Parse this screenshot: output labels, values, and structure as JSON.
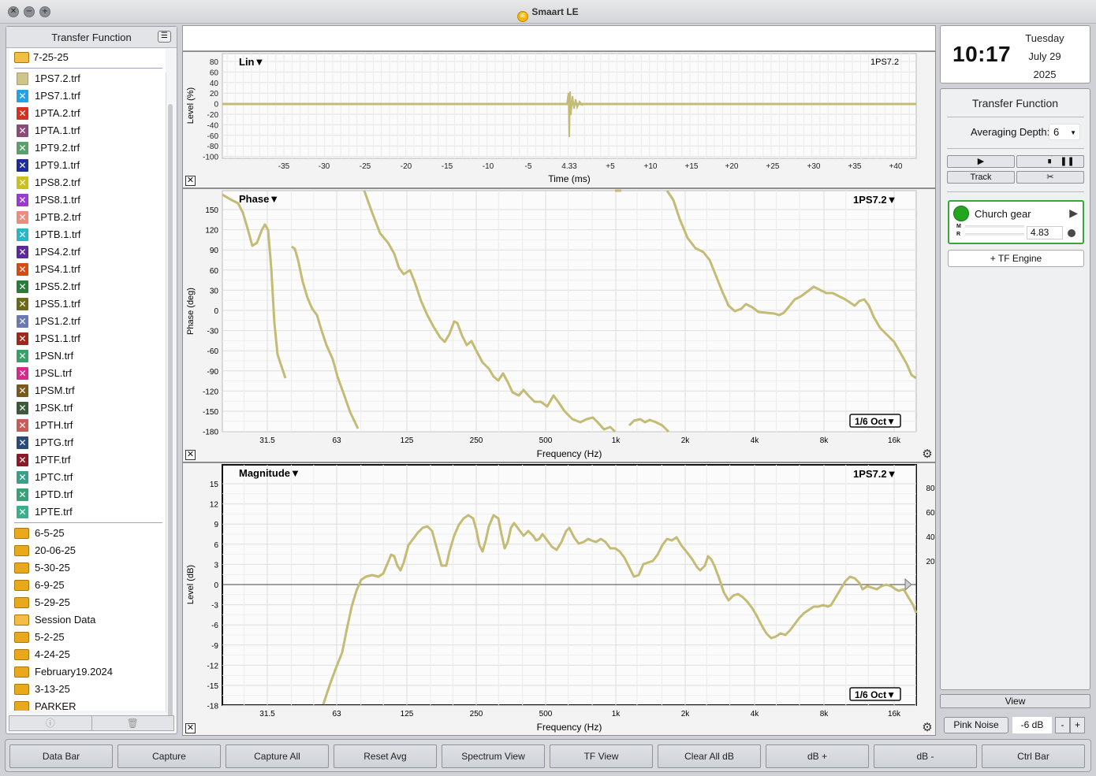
{
  "window": {
    "title": "Smaart LE",
    "logo_text": "iE"
  },
  "sidebar": {
    "title": "Transfer Function",
    "current_folder": "7-25-25",
    "files": [
      {
        "name": "1PS7.2.trf",
        "color": "plain"
      },
      {
        "name": "1PS7.1.trf",
        "color": "#23a3e6"
      },
      {
        "name": "1PTA.2.trf",
        "color": "#d63020"
      },
      {
        "name": "1PTA.1.trf",
        "color": "#8a4a7a"
      },
      {
        "name": "1PT9.2.trf",
        "color": "#5aa06a"
      },
      {
        "name": "1PT9.1.trf",
        "color": "#1d2c9a"
      },
      {
        "name": "1PS8.2.trf",
        "color": "#c9c21a"
      },
      {
        "name": "1PS8.1.trf",
        "color": "#9a3ad0"
      },
      {
        "name": "1PTB.2.trf",
        "color": "#ef8b7e"
      },
      {
        "name": "1PTB.1.trf",
        "color": "#2ab6c9"
      },
      {
        "name": "1PS4.2.trf",
        "color": "#5a2a9a"
      },
      {
        "name": "1PS4.1.trf",
        "color": "#d64a14"
      },
      {
        "name": "1PS5.2.trf",
        "color": "#2a7a3a"
      },
      {
        "name": "1PS5.1.trf",
        "color": "#6b6a1a"
      },
      {
        "name": "1PS1.2.trf",
        "color": "#6a7ab0"
      },
      {
        "name": "1PS1.1.trf",
        "color": "#a0281a"
      },
      {
        "name": "1PSN.trf",
        "color": "#3aa06a"
      },
      {
        "name": "1PSL.trf",
        "color": "#d62a8a"
      },
      {
        "name": "1PSM.trf",
        "color": "#7a5a1a"
      },
      {
        "name": "1PSK.trf",
        "color": "#3a5a3a"
      },
      {
        "name": "1PTH.trf",
        "color": "#c95a5a"
      },
      {
        "name": "1PTG.trf",
        "color": "#2a4a7a"
      },
      {
        "name": "1PTF.trf",
        "color": "#8a1a2a"
      },
      {
        "name": "1PTC.trf",
        "color": "#3aa08a"
      },
      {
        "name": "1PTD.trf",
        "color": "#3aa07a"
      },
      {
        "name": "1PTE.trf",
        "color": "#3ab08a"
      }
    ],
    "folders": [
      "6-5-25",
      "20-06-25",
      "5-30-25",
      "6-9-25",
      "5-29-25",
      "Session Data",
      "5-2-25",
      "4-24-25",
      "February19.2024",
      "3-13-25",
      "PARKER"
    ],
    "open_folders": [
      "Session Data"
    ]
  },
  "plots": {
    "lin": {
      "mode_label": "Lin▼",
      "trace_label": "1PS7.2",
      "ylabel": "Level (%)",
      "xlabel": "Time (ms)",
      "yticks": [
        "80",
        "60",
        "40",
        "20",
        "0",
        "-20",
        "-40",
        "-60",
        "-80",
        "-100"
      ],
      "xticks": [
        "-35",
        "-30",
        "-25",
        "-20",
        "-15",
        "-10",
        "-5",
        "4.33",
        "+5",
        "+10",
        "+15",
        "+20",
        "+25",
        "+30",
        "+35",
        "+40"
      ]
    },
    "phase": {
      "mode_label": "Phase▼",
      "trace_label": "1PS7.2▼",
      "smoothing": "1/6 Oct▼",
      "ylabel": "Phase (deg)",
      "xlabel": "Frequency (Hz)",
      "yticks": [
        "150",
        "120",
        "90",
        "60",
        "30",
        "0",
        "-30",
        "-60",
        "-90",
        "-120",
        "-150",
        "-180"
      ],
      "xticks": [
        "31.5",
        "63",
        "125",
        "250",
        "500",
        "1k",
        "2k",
        "4k",
        "8k",
        "16k"
      ]
    },
    "magnitude": {
      "mode_label": "Magnitude▼",
      "trace_label": "1PS7.2▼",
      "smoothing": "1/6 Oct▼",
      "ylabel": "Level (dB)",
      "xlabel": "Frequency (Hz)",
      "yticks": [
        "15",
        "12",
        "9",
        "6",
        "3",
        "0",
        "-3",
        "-6",
        "-9",
        "-12",
        "-15",
        "-18"
      ],
      "yticks_right": [
        "80",
        "60",
        "40",
        "20"
      ],
      "xticks": [
        "31.5",
        "63",
        "125",
        "250",
        "500",
        "1k",
        "2k",
        "4k",
        "8k",
        "16k"
      ]
    },
    "trace_color": "#c4bb74"
  },
  "clock": {
    "time": "10:17",
    "day": "Tuesday",
    "date": "July 29",
    "year": "2025"
  },
  "tf_panel": {
    "title": "Transfer Function",
    "averaging_label": "Averaging Depth:",
    "averaging_value": "6",
    "track_label": "Track",
    "measurement": {
      "name": "Church gear",
      "m_label": "M",
      "r_label": "R",
      "delay": "4.83"
    },
    "engine_button": "+ TF Engine"
  },
  "view_button": "View",
  "pink_noise": {
    "label": "Pink Noise",
    "level": "-6 dB",
    "minus": "-",
    "plus": "+"
  },
  "bottom_bar": [
    "Data Bar",
    "Capture",
    "Capture All",
    "Reset Avg",
    "Spectrum View",
    "TF View",
    "Clear All dB",
    "dB +",
    "dB -",
    "Ctrl Bar"
  ]
}
